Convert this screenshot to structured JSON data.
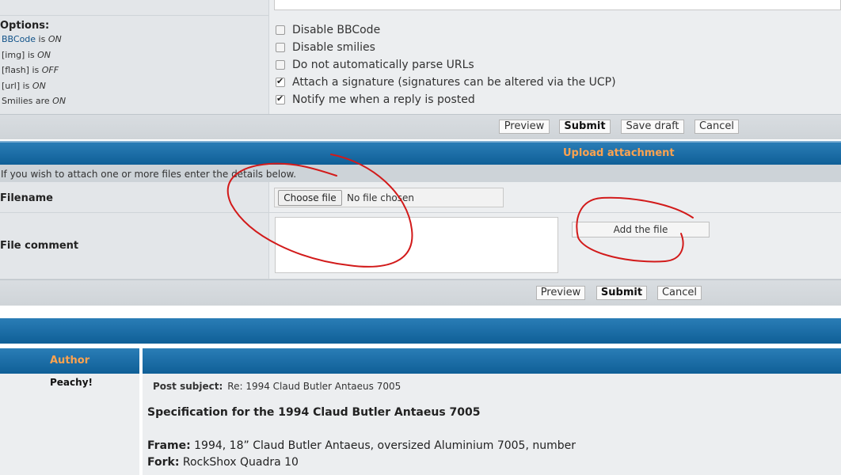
{
  "options": {
    "title": "Options:",
    "status_lines": [
      {
        "link": "BBCode",
        "mid": " is ",
        "state": "ON"
      },
      {
        "link": "",
        "mid": "[img] is ",
        "state": "ON"
      },
      {
        "link": "",
        "mid": "[flash] is ",
        "state": "OFF"
      },
      {
        "link": "",
        "mid": "[url] is ",
        "state": "ON"
      },
      {
        "link": "",
        "mid": "Smilies are ",
        "state": "ON"
      }
    ],
    "checkboxes": [
      {
        "label": "Disable BBCode",
        "checked": false
      },
      {
        "label": "Disable smilies",
        "checked": false
      },
      {
        "label": "Do not automatically parse URLs",
        "checked": false
      },
      {
        "label": "Attach a signature (signatures can be altered via the UCP)",
        "checked": true
      },
      {
        "label": "Notify me when a reply is posted",
        "checked": true
      }
    ]
  },
  "buttons_top": {
    "preview": "Preview",
    "submit": "Submit",
    "save_draft": "Save draft",
    "cancel": "Cancel"
  },
  "upload": {
    "heading": "Upload attachment",
    "info": "If you wish to attach one or more files enter the details below.",
    "filename_label": "Filename",
    "choose_file": "Choose file",
    "no_file": "No file chosen",
    "comment_label": "File comment",
    "add_file": "Add the file"
  },
  "buttons_bottom": {
    "preview": "Preview",
    "submit": "Submit",
    "cancel": "Cancel"
  },
  "post": {
    "author_heading": "Author",
    "author": "Peachy!",
    "subject_label": "Post subject:",
    "subject": "Re: 1994 Claud Butler Antaeus 7005",
    "title": "Specification for the 1994 Claud Butler Antaeus 7005",
    "frame_label": "Frame:",
    "frame": " 1994, 18” Claud Butler Antaeus, oversized Aluminium 7005, number",
    "fork_label": "Fork:",
    "fork": " RockShox Quadra 10"
  },
  "colors": {
    "header_blue": "#0f5f97",
    "header_text": "#ffa34f",
    "annotation_red": "#d21a1a",
    "link": "#105289"
  }
}
